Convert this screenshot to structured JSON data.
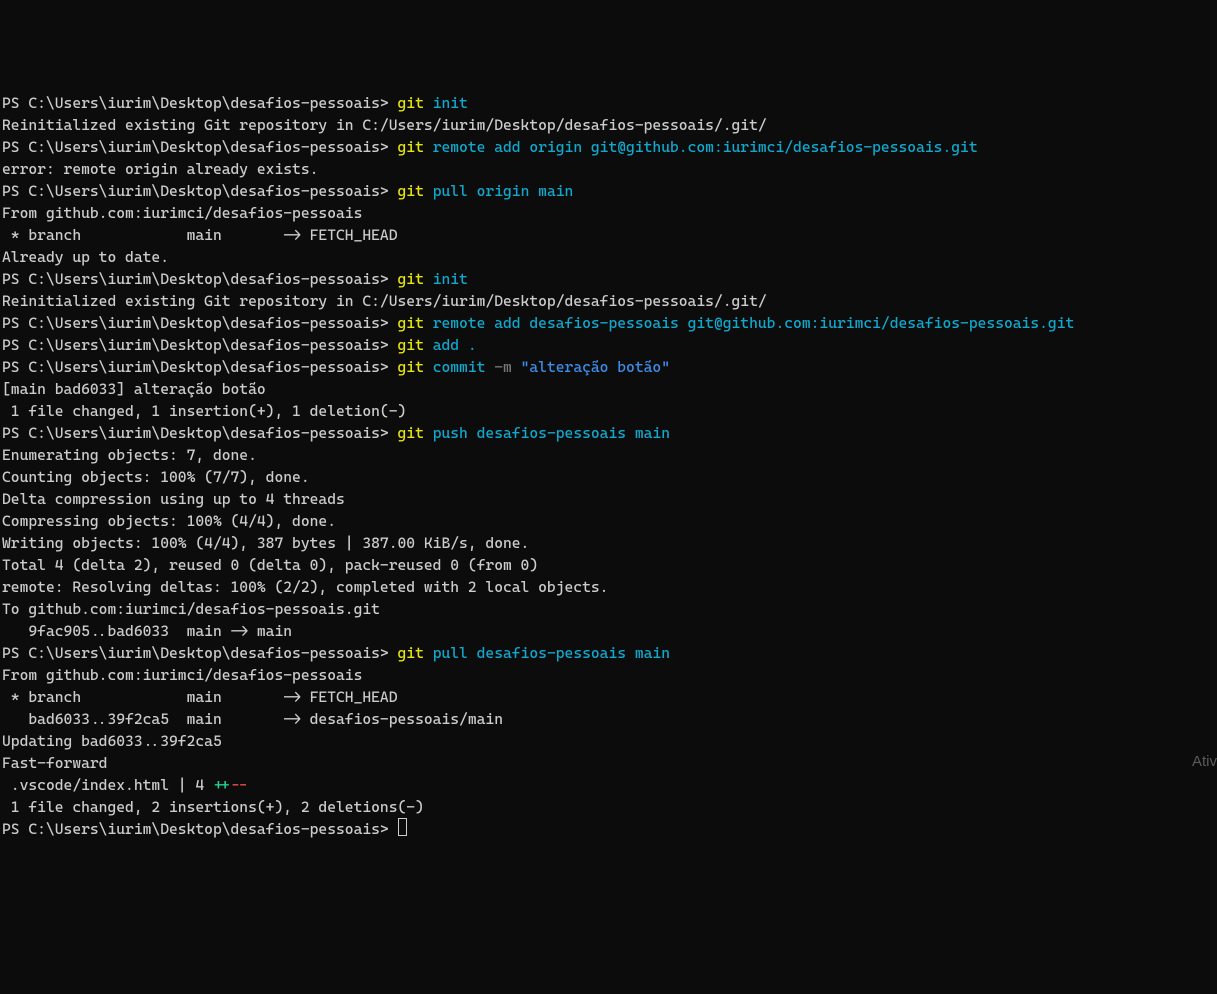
{
  "prompt": "PS C:\\Users\\iurim\\Desktop\\desafios-pessoais> ",
  "cmd": {
    "git": "git",
    "init": "init",
    "remote_add_origin": "remote add origin git@github.com:iurimci/desafios-pessoais.git",
    "pull_origin_main": "pull origin main",
    "remote_add_desafios": "remote add desafios-pessoais git@github.com:iurimci/desafios-pessoais.git",
    "add_dot": "add .",
    "commit": "commit",
    "commit_flag": " -m ",
    "commit_msg": "\"alteração botão\"",
    "push_desafios": "push desafios-pessoais main",
    "pull_desafios": "pull desafios-pessoais main"
  },
  "out": {
    "reinit": "Reinitialized existing Git repository in C:/Users/iurim/Desktop/desafios-pessoais/.git/",
    "err_remote_exists": "error: remote origin already exists.",
    "from_repo": "From github.com:iurimci/desafios-pessoais",
    "branch_fetch_head": " * branch            main       -> FETCH_HEAD",
    "already_up": "Already up to date.",
    "commit_result": "[main bad6033] alteração botão",
    "commit_stats": " 1 file changed, 1 insertion(+), 1 deletion(-)",
    "enumerating": "Enumerating objects: 7, done.",
    "counting": "Counting objects: 100% (7/7), done.",
    "delta_comp": "Delta compression using up to 4 threads",
    "compressing": "Compressing objects: 100% (4/4), done.",
    "writing": "Writing objects: 100% (4/4), 387 bytes | 387.00 KiB/s, done.",
    "total": "Total 4 (delta 2), reused 0 (delta 0), pack-reused 0 (from 0)",
    "remote_resolving": "remote: Resolving deltas: 100% (2/2), completed with 2 local objects.",
    "to_repo": "To github.com:iurimci/desafios-pessoais.git",
    "push_ref": "   9fac905..bad6033  main -> main",
    "branch_tracking": "   bad6033..39f2ca5  main       -> desafios-pessoais/main",
    "updating": "Updating bad6033..39f2ca5",
    "fast_forward": "Fast-forward",
    "diff_file": " .vscode/index.html | 4 ",
    "diff_plus": "++",
    "diff_minus": "--",
    "diff_stats": " 1 file changed, 2 insertions(+), 2 deletions(-)"
  },
  "watermark": "Ativ"
}
